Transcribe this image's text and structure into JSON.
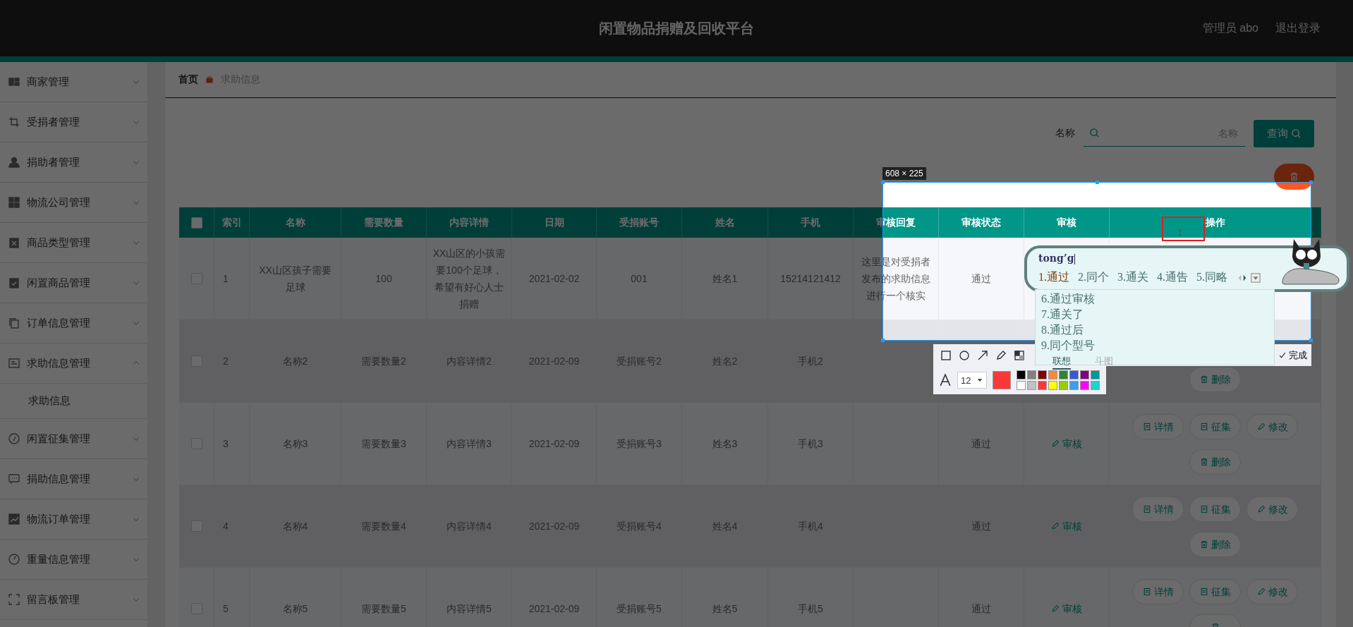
{
  "header": {
    "title": "闲置物品捐赠及回收平台",
    "user": "管理员 abo",
    "logout": "退出登录"
  },
  "sidebar": {
    "items": [
      {
        "label": "商家管理",
        "expanded": false
      },
      {
        "label": "受捐者管理",
        "expanded": false
      },
      {
        "label": "捐助者管理",
        "expanded": false
      },
      {
        "label": "物流公司管理",
        "expanded": false
      },
      {
        "label": "商品类型管理",
        "expanded": false
      },
      {
        "label": "闲置商品管理",
        "expanded": false
      },
      {
        "label": "订单信息管理",
        "expanded": false
      },
      {
        "label": "求助信息管理",
        "expanded": true,
        "children": [
          {
            "label": "求助信息"
          }
        ]
      },
      {
        "label": "闲置征集管理",
        "expanded": false
      },
      {
        "label": "捐助信息管理",
        "expanded": false
      },
      {
        "label": "物流订单管理",
        "expanded": false
      },
      {
        "label": "重量信息管理",
        "expanded": false
      },
      {
        "label": "留言板管理",
        "expanded": false
      }
    ]
  },
  "breadcrumb": [
    "首页",
    "求助信息"
  ],
  "search": {
    "label": "名称",
    "placeholder": "名称",
    "button": "查询"
  },
  "table": {
    "select_all_checked": false,
    "columns": [
      "索引",
      "名称",
      "需要数量",
      "内容详情",
      "日期",
      "受捐账号",
      "姓名",
      "手机",
      "审核回复",
      "审核状态",
      "审核",
      "操作"
    ],
    "rows": [
      {
        "checked": false,
        "index": "1",
        "name": "XX山区孩子需要足球",
        "quantity": "100",
        "content": "XX山区的小孩需要100个足球，希望有好心人士捐赠",
        "date": "2021-02-02",
        "account": "001",
        "person": "姓名1",
        "phone": "15214121412",
        "reply": "这里是对受捐者发布的求助信息进行一个核实",
        "status": "通过"
      },
      {
        "checked": false,
        "index": "2",
        "name": "名称2",
        "quantity": "需要数量2",
        "content": "内容详情2",
        "date": "2021-02-09",
        "account": "受捐账号2",
        "person": "姓名2",
        "phone": "手机2",
        "actions_line_2": [
          {
            "kind": "delete",
            "label": "删除"
          }
        ]
      },
      {
        "checked": false,
        "index": "3",
        "name": "名称3",
        "quantity": "需要数量3",
        "content": "内容详情3",
        "date": "2021-02-09",
        "account": "受捐账号3",
        "person": "姓名3",
        "phone": "手机3",
        "status": "通过",
        "review": "审核",
        "actions_line_1": [
          {
            "kind": "detail",
            "label": "详情"
          },
          {
            "kind": "collect",
            "label": "征集"
          },
          {
            "kind": "edit",
            "label": "修改"
          }
        ],
        "actions_line_2": [
          {
            "kind": "delete",
            "label": "删除"
          }
        ]
      },
      {
        "checked": false,
        "index": "4",
        "name": "名称4",
        "quantity": "需要数量4",
        "content": "内容详情4",
        "date": "2021-02-09",
        "account": "受捐账号4",
        "person": "姓名4",
        "phone": "手机4",
        "status": "通过",
        "review": "审核",
        "actions_line_1": [
          {
            "kind": "detail",
            "label": "详情"
          },
          {
            "kind": "collect",
            "label": "征集"
          },
          {
            "kind": "edit",
            "label": "修改"
          }
        ],
        "actions_line_2": [
          {
            "kind": "delete",
            "label": "删除"
          }
        ]
      },
      {
        "checked": false,
        "index": "5",
        "name": "名称5",
        "quantity": "需要数量5",
        "content": "内容详情5",
        "date": "2021-02-09",
        "account": "受捐账号5",
        "person": "姓名5",
        "phone": "手机5",
        "status": "通过",
        "review": "审核",
        "actions_line_1": [
          {
            "kind": "detail",
            "label": "详情"
          },
          {
            "kind": "collect",
            "label": "征集"
          },
          {
            "kind": "edit",
            "label": "修改"
          }
        ],
        "actions_line_2": [
          {
            "kind": "delete"
          }
        ]
      }
    ]
  },
  "screenshot_tool": {
    "size_label": "608 × 225",
    "done": "完成",
    "font_size": "12",
    "current_swatch": {
      "color": "#fb3838"
    },
    "palette": [
      {
        "color": "#000000"
      },
      {
        "color": "#808080"
      },
      {
        "color": "#800000"
      },
      {
        "color": "#f7883a"
      },
      {
        "color": "#308430"
      },
      {
        "color": "#385ad3"
      },
      {
        "color": "#800080"
      },
      {
        "color": "#009999"
      },
      {
        "color": "#ffffff"
      },
      {
        "color": "#c0c0c0"
      },
      {
        "color": "#fb3838"
      },
      {
        "color": "#ffff00"
      },
      {
        "color": "#99cc00"
      },
      {
        "color": "#3d9eeb"
      },
      {
        "color": "#ff00ff"
      },
      {
        "color": "#20d3d3"
      }
    ]
  },
  "ime": {
    "composition": "tong’g",
    "candidates": [
      {
        "label": "1.通过",
        "selected": true
      },
      {
        "label": "2.同个",
        "selected": false
      },
      {
        "label": "3.通关",
        "selected": false
      },
      {
        "label": "4.通告",
        "selected": false
      },
      {
        "label": "5.同略",
        "selected": false
      }
    ],
    "more_candidates": [
      "6.通过审核",
      "7.通关了",
      "8.通过后",
      "9.同个型号"
    ],
    "tabs": [
      {
        "label": "联想",
        "selected": true
      },
      {
        "label": "斗图",
        "selected": false
      }
    ]
  }
}
